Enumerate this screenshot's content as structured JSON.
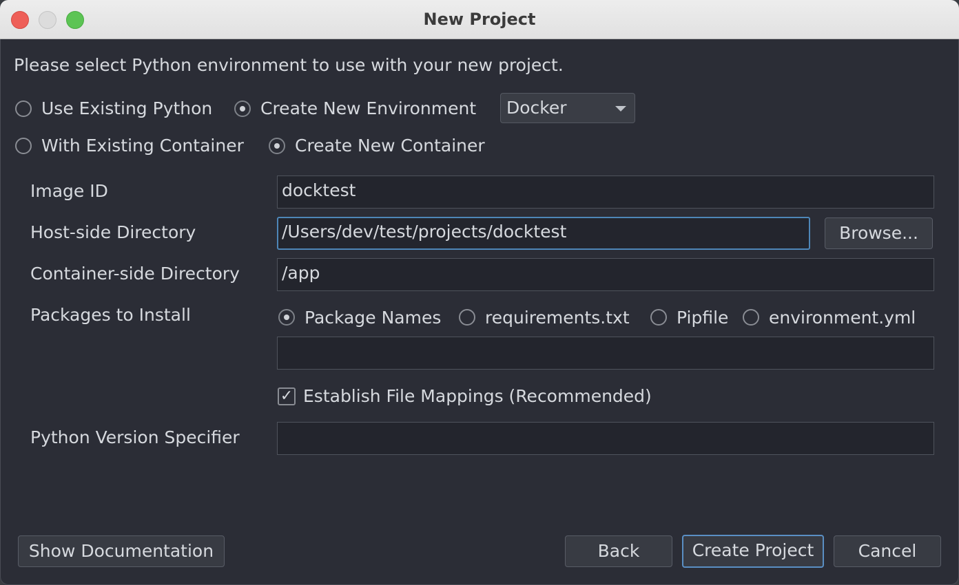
{
  "window": {
    "title": "New Project"
  },
  "intro": "Please select Python environment to use with your new project.",
  "env_mode": {
    "use_existing": "Use Existing Python",
    "create_new": "Create New Environment",
    "env_type": "Docker"
  },
  "container_mode": {
    "with_existing": "With Existing Container",
    "create_new": "Create New Container"
  },
  "form": {
    "image_id_label": "Image ID",
    "image_id_value": "docktest",
    "host_dir_label": "Host-side Directory",
    "host_dir_value": "/Users/dev/test/projects/docktest",
    "browse_label": "Browse...",
    "container_dir_label": "Container-side Directory",
    "container_dir_value": "/app",
    "packages_label": "Packages to Install",
    "pkg_options": {
      "package_names": "Package Names",
      "requirements": "requirements.txt",
      "pipfile": "Pipfile",
      "environment": "environment.yml"
    },
    "packages_value": "",
    "mappings_check": "✓",
    "mappings_label": "Establish File Mappings (Recommended)",
    "python_version_label": "Python Version Specifier",
    "python_version_value": ""
  },
  "footer": {
    "show_docs": "Show Documentation",
    "back": "Back",
    "create": "Create Project",
    "cancel": "Cancel"
  }
}
